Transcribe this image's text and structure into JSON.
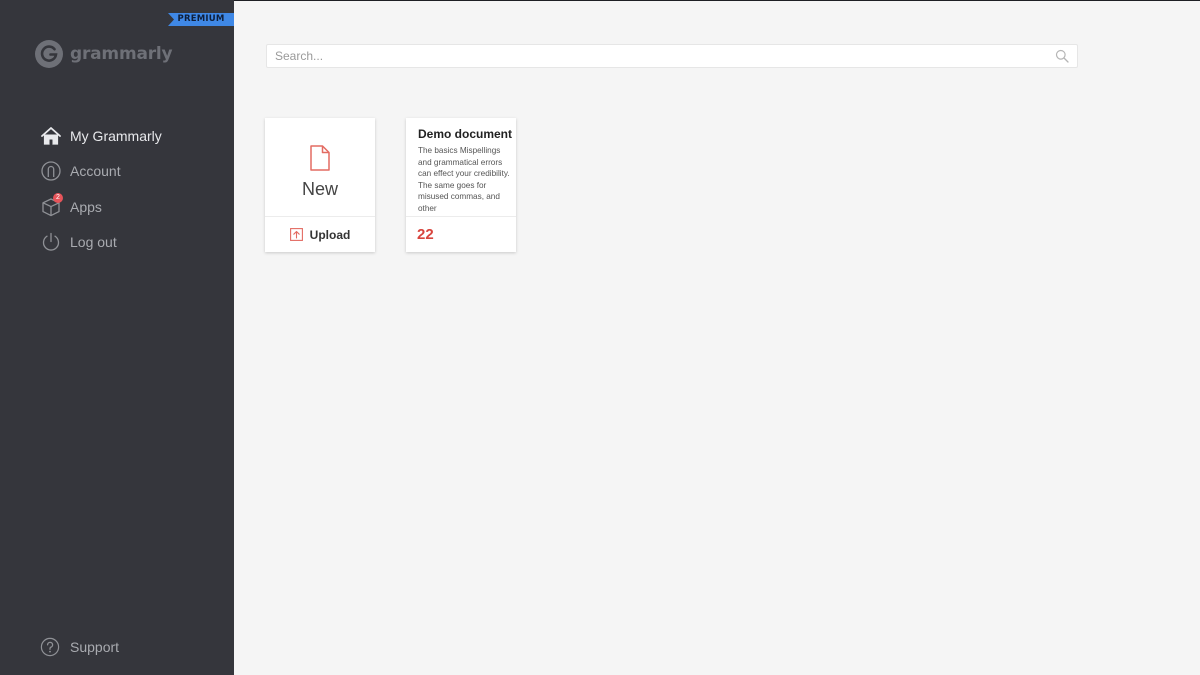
{
  "sidebar": {
    "badge": "PREMIUM",
    "logo_text": "grammarly",
    "items": [
      {
        "label": "My Grammarly",
        "icon": "home-icon",
        "active": true
      },
      {
        "label": "Account",
        "icon": "account-icon"
      },
      {
        "label": "Apps",
        "icon": "apps-box-icon",
        "badge_count": "2"
      },
      {
        "label": "Log out",
        "icon": "power-icon"
      }
    ],
    "support_label": "Support"
  },
  "search": {
    "placeholder": "Search..."
  },
  "cards": {
    "new": {
      "label": "New",
      "upload_label": "Upload"
    },
    "document": {
      "title": "Demo document",
      "excerpt": "The basics Mispellings and grammatical errors can effect your credibility. The same goes for misused commas, and other",
      "score": "22"
    }
  },
  "colors": {
    "sidebar_bg": "#35363c",
    "premium_blue": "#3f88e6",
    "accent_red": "#d8453e",
    "main_bg": "#f5f5f5"
  }
}
